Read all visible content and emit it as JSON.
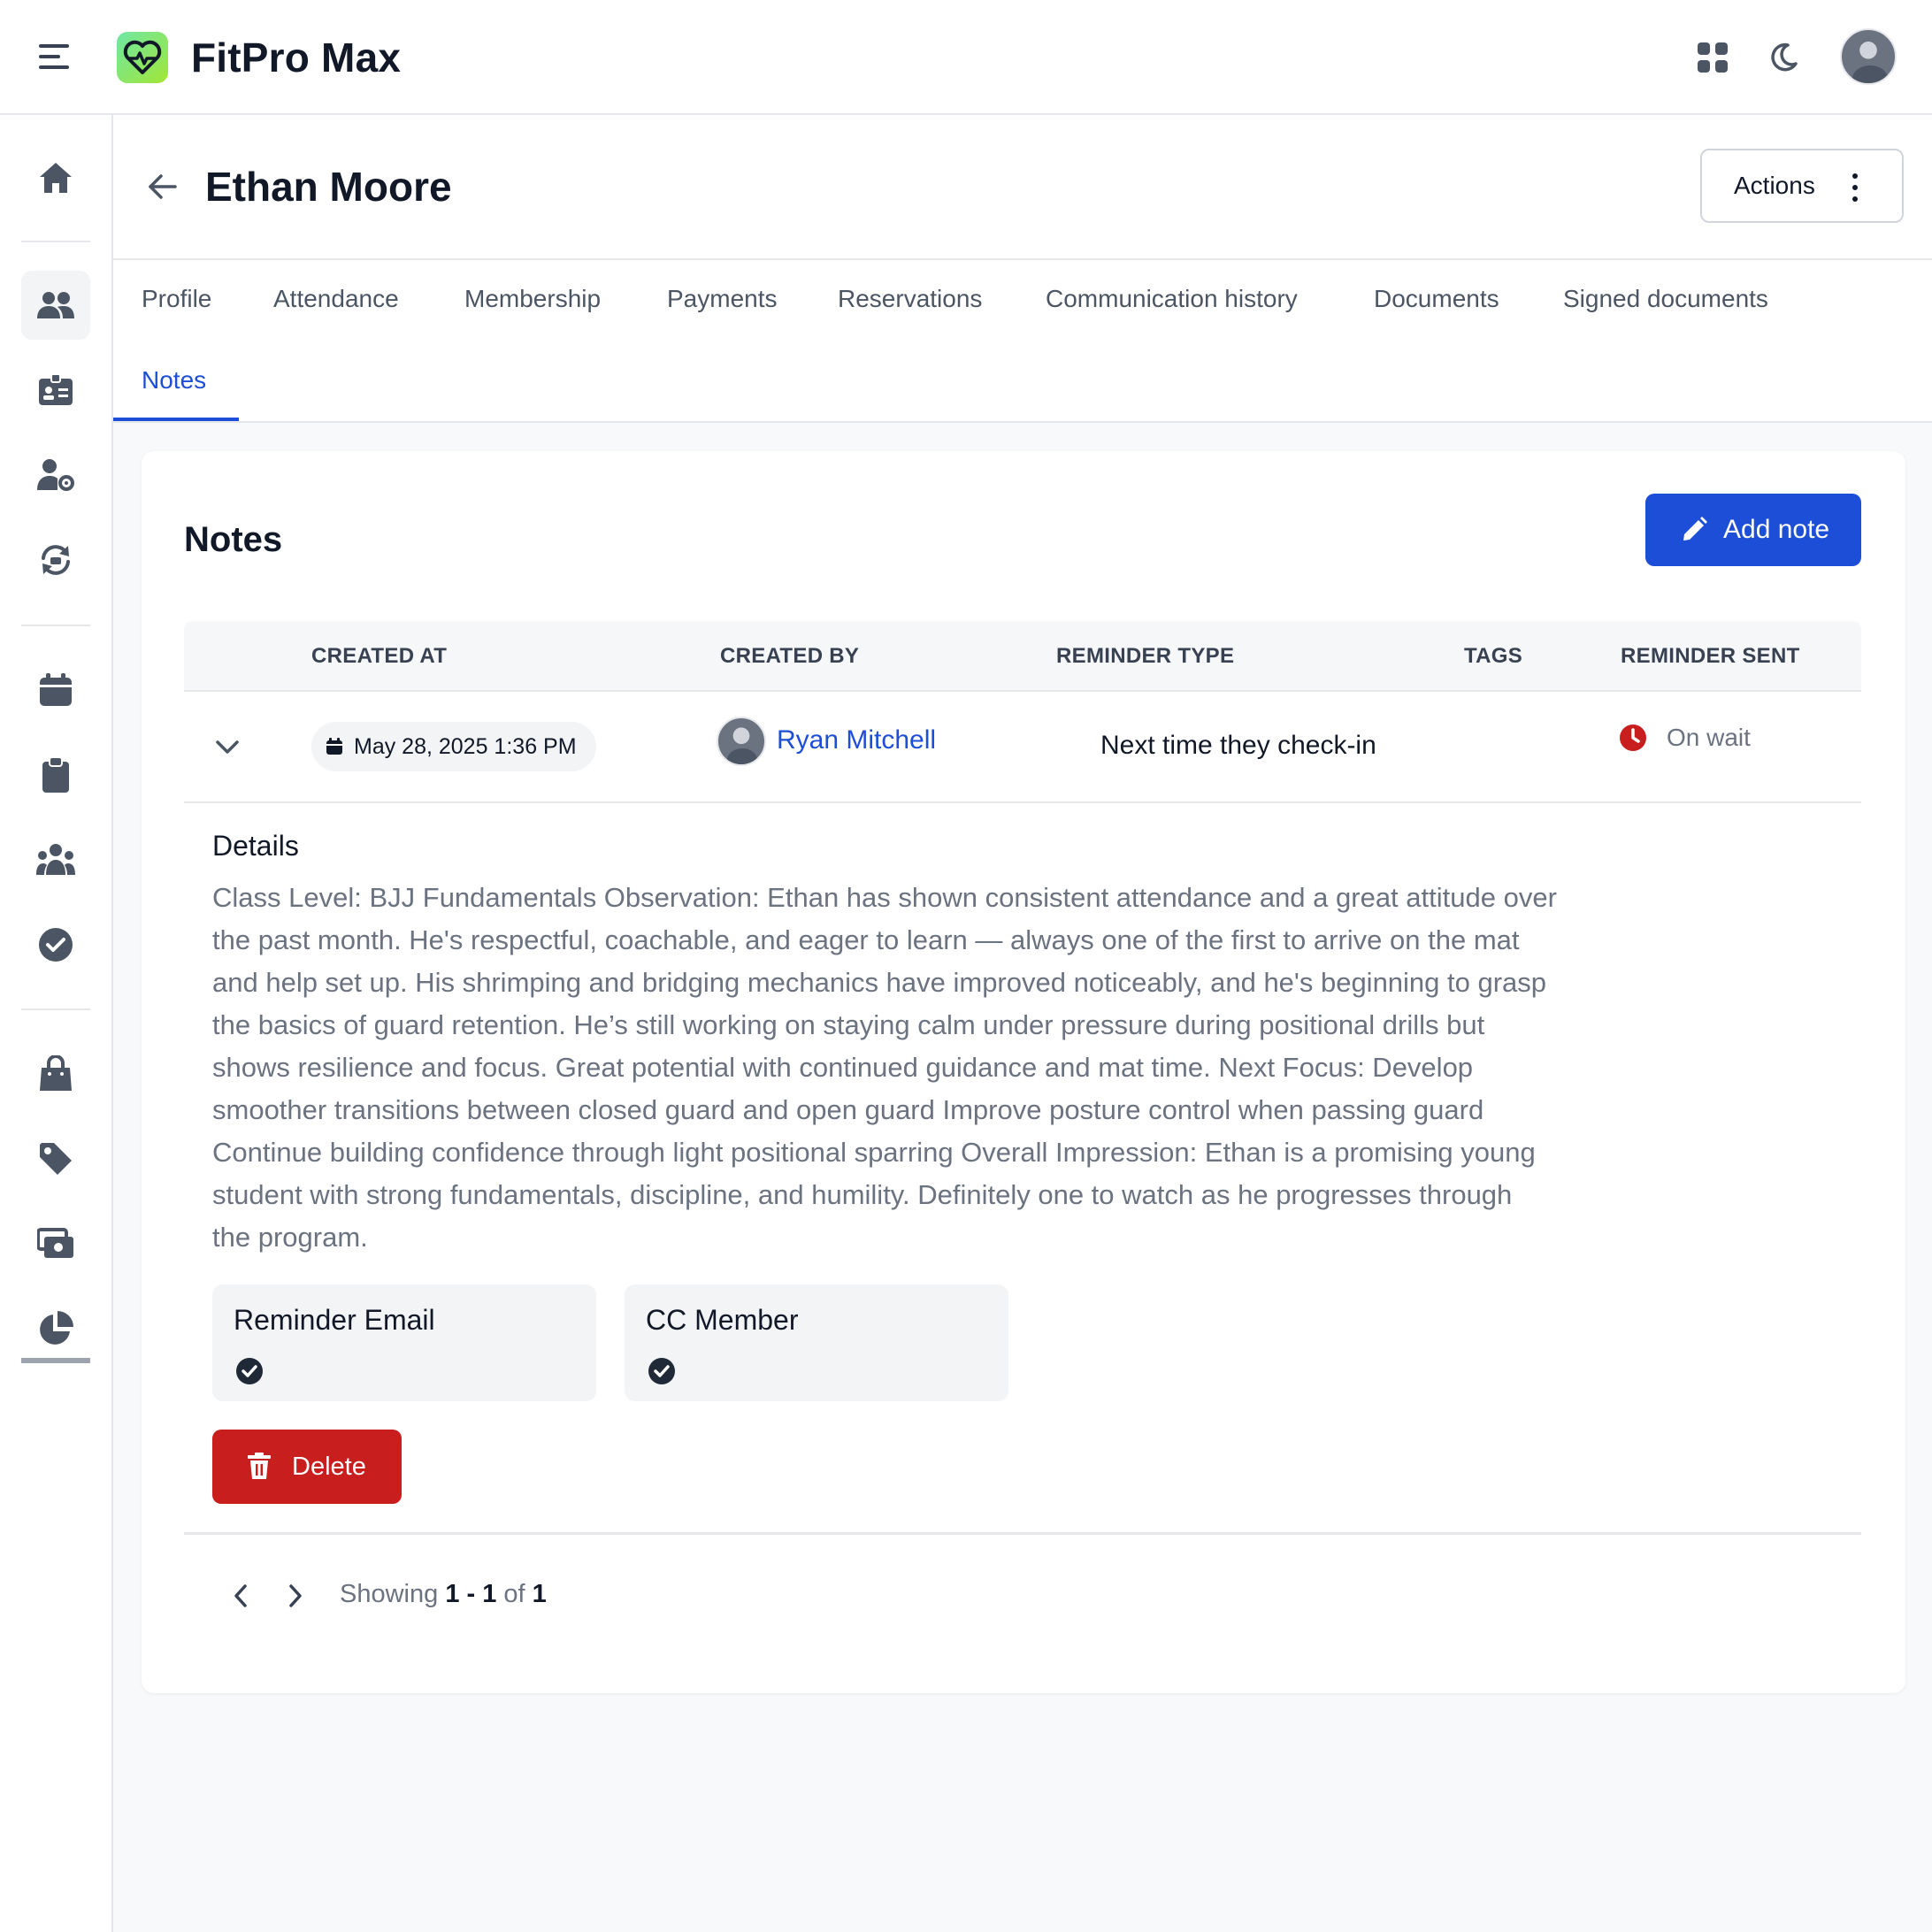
{
  "app": {
    "title": "FitPro Max"
  },
  "colors": {
    "accent": "#1d4ed8",
    "danger": "#c81e1e",
    "status_wait": "#c81e1e",
    "logo_gradient_start": "#6ee7a5",
    "logo_gradient_end": "#a3e635"
  },
  "topbar": {
    "icons": [
      "menu-icon",
      "apps-grid-icon",
      "dark-mode-moon-icon",
      "user-avatar"
    ]
  },
  "sidebar": {
    "items": [
      {
        "icon": "home-icon"
      },
      {
        "icon": "members-icon",
        "active": true
      },
      {
        "icon": "id-card-icon"
      },
      {
        "icon": "staff-settings-icon"
      },
      {
        "icon": "sync-icon"
      },
      {
        "icon": "calendar-icon"
      },
      {
        "icon": "clipboard-icon"
      },
      {
        "icon": "groups-icon"
      },
      {
        "icon": "check-circle-icon"
      },
      {
        "icon": "shopping-bag-icon"
      },
      {
        "icon": "tag-icon"
      },
      {
        "icon": "payments-icon"
      },
      {
        "icon": "pie-chart-icon"
      }
    ]
  },
  "header": {
    "member_name": "Ethan Moore",
    "actions_label": "Actions"
  },
  "tabs": [
    {
      "label": "Profile"
    },
    {
      "label": "Attendance"
    },
    {
      "label": "Membership"
    },
    {
      "label": "Payments"
    },
    {
      "label": "Reservations"
    },
    {
      "label": "Communication history"
    },
    {
      "label": "Documents"
    },
    {
      "label": "Signed documents"
    },
    {
      "label": "Notes",
      "active": true
    }
  ],
  "notes": {
    "title": "Notes",
    "add_button": "Add note",
    "columns": [
      "CREATED AT",
      "CREATED BY",
      "REMINDER TYPE",
      "TAGS",
      "REMINDER SENT"
    ],
    "rows": [
      {
        "created_at": "May 28, 2025 1:36 PM",
        "created_by": "Ryan Mitchell",
        "reminder_type": "Next time they check-in",
        "tags": "",
        "reminder_sent": "On wait",
        "details_title": "Details",
        "details": "Class Level: BJJ Fundamentals Observation: Ethan has shown consistent attendance and a great attitude over the past month. He's respectful, coachable, and eager to learn — always one of the first to arrive on the mat and help set up. His shrimping and bridging mechanics have improved noticeably, and he's beginning to grasp the basics of guard retention. He’s still working on staying calm under pressure during positional drills but shows resilience and focus. Great potential with continued guidance and mat time. Next Focus: Develop smoother transitions between closed guard and open guard Improve posture control when passing guard Continue building confidence through light positional sparring Overall Impression: Ethan is a promising young student with strong fundamentals, discipline, and humility. Definitely one to watch as he progresses through the program.",
        "flags": [
          {
            "label": "Reminder Email",
            "checked": true
          },
          {
            "label": "CC Member",
            "checked": true
          }
        ],
        "delete_label": "Delete"
      }
    ],
    "pagination": {
      "showing_label": "Showing",
      "range": "1 - 1",
      "of_label": "of",
      "total": "1"
    }
  }
}
